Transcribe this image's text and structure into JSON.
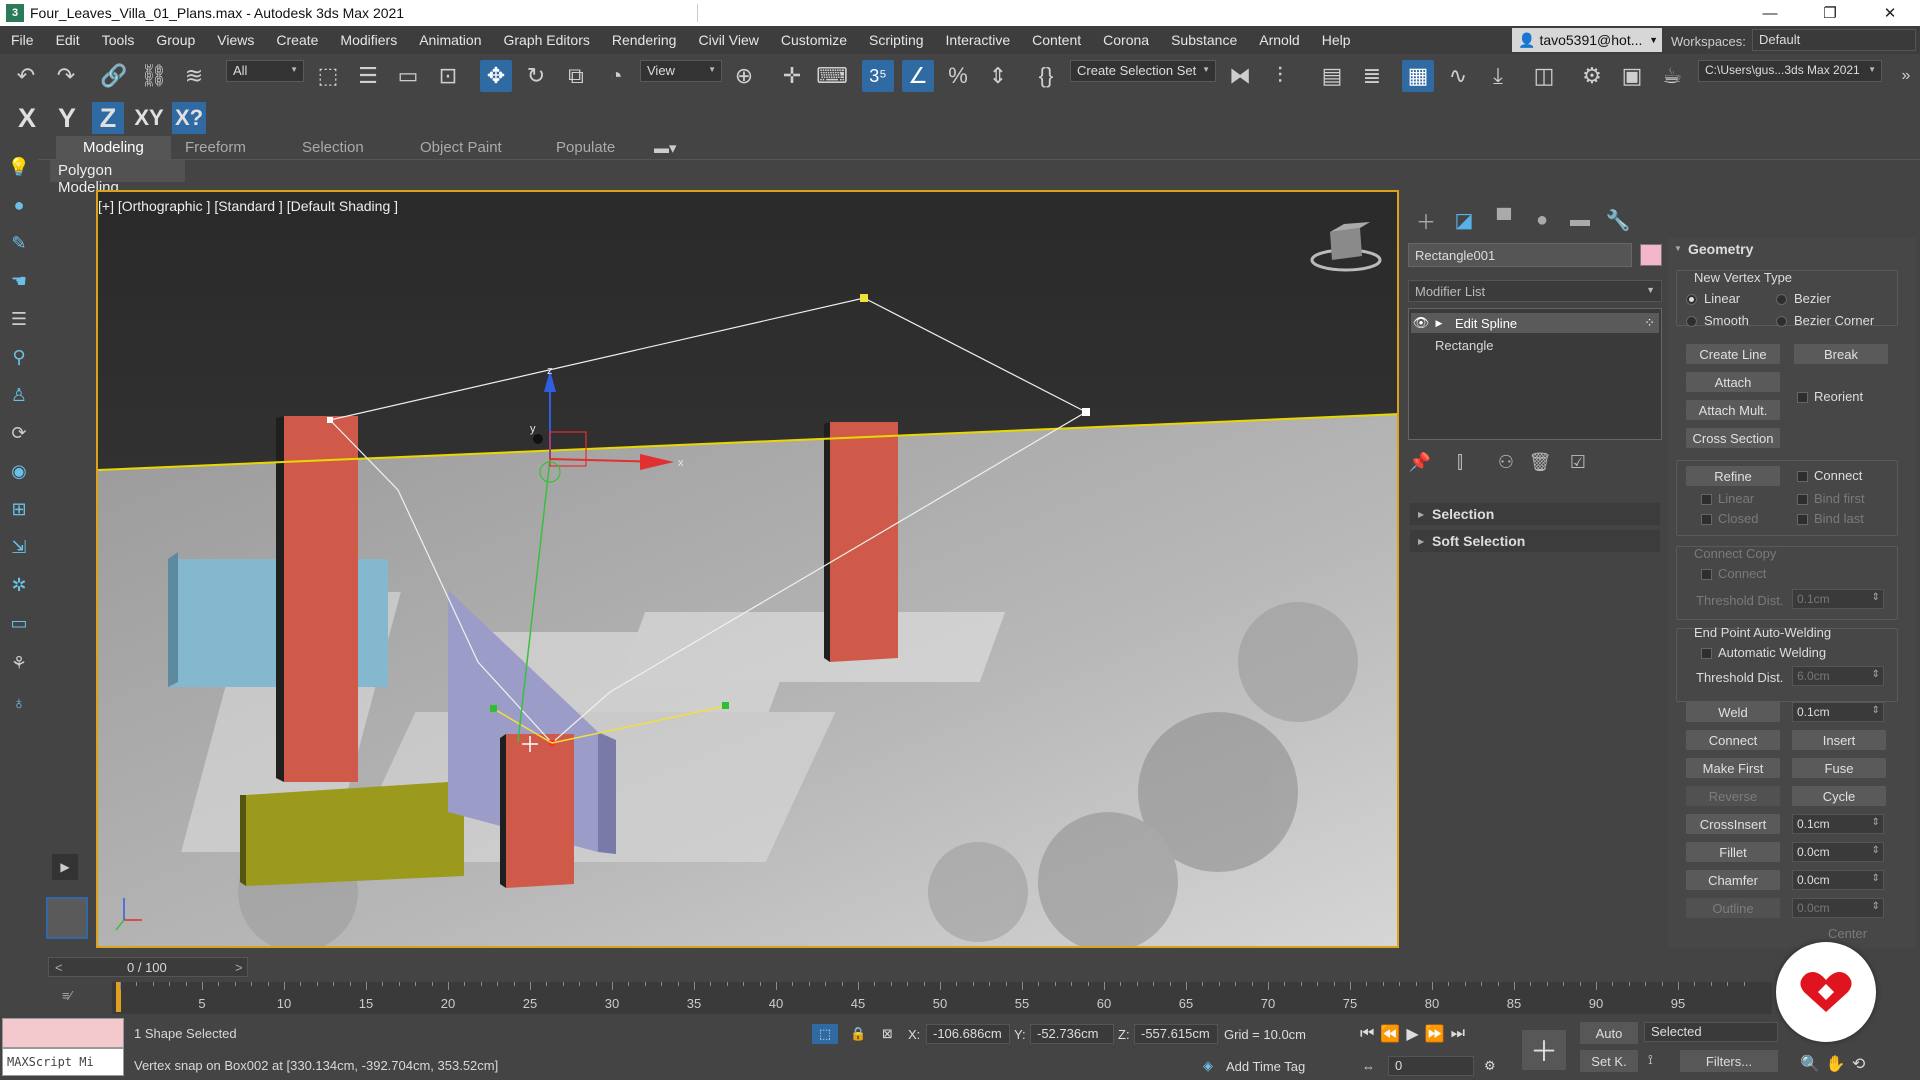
{
  "window": {
    "title": "Four_Leaves_Villa_01_Plans.max - Autodesk 3ds Max 2021",
    "app_icon": "3",
    "minimize": "—",
    "maximize": "❐",
    "close": "✕"
  },
  "menu": [
    "File",
    "Edit",
    "Tools",
    "Group",
    "Views",
    "Create",
    "Modifiers",
    "Animation",
    "Graph Editors",
    "Rendering",
    "Civil View",
    "Customize",
    "Scripting",
    "Interactive",
    "Content",
    "Corona",
    "Substance",
    "Arnold",
    "Help"
  ],
  "user": {
    "name": "tavo5391@hot...",
    "workspaces_label": "Workspaces:",
    "workspace": "Default"
  },
  "toolbar": {
    "filter": "All",
    "ref_coord": "View",
    "selection_set": "Create Selection Set",
    "project_path": "C:\\Users\\gus...3ds Max 2021"
  },
  "axis": {
    "x": "X",
    "y": "Y",
    "z": "Z",
    "xy": "XY",
    "xz": "X?"
  },
  "ribbon": {
    "tabs": [
      "Modeling",
      "Freeform",
      "Selection",
      "Object Paint",
      "Populate"
    ],
    "panel": "Polygon Modeling"
  },
  "viewport": {
    "label": "[+] [Orthographic ] [Standard ] [Default Shading ]",
    "axis_x": "x",
    "axis_y": "y",
    "axis_z": "z"
  },
  "command_panel": {
    "object_name": "Rectangle001",
    "object_color": "#f4b6cd",
    "modifier_list": "Modifier List",
    "stack": [
      "Edit Spline",
      "Rectangle"
    ],
    "rollouts": [
      "Selection",
      "Soft Selection"
    ]
  },
  "geometry": {
    "title": "Geometry",
    "new_vertex_type": "New Vertex Type",
    "linear": "Linear",
    "bezier": "Bezier",
    "smooth": "Smooth",
    "bezier_corner": "Bezier Corner",
    "create_line": "Create Line",
    "break": "Break",
    "attach": "Attach",
    "reorient": "Reorient",
    "attach_mult": "Attach Mult.",
    "cross_section": "Cross Section",
    "refine": "Refine",
    "connect": "Connect",
    "ref_linear": "Linear",
    "bind_first": "Bind first",
    "closed": "Closed",
    "bind_last": "Bind last",
    "connect_copy": "Connect Copy",
    "cc_connect": "Connect",
    "threshold_dist": "Threshold Dist.",
    "threshold_val1": "0.1cm",
    "end_point": "End Point Auto-Welding",
    "auto_weld": "Automatic Welding",
    "threshold_val2": "6.0cm",
    "weld": "Weld",
    "weld_val": "0.1cm",
    "connect_btn": "Connect",
    "insert": "Insert",
    "make_first": "Make First",
    "fuse": "Fuse",
    "reverse": "Reverse",
    "cycle": "Cycle",
    "crossinsert": "CrossInsert",
    "crossinsert_val": "0.1cm",
    "fillet": "Fillet",
    "fillet_val": "0.0cm",
    "chamfer": "Chamfer",
    "chamfer_val": "0.0cm",
    "outline": "Outline",
    "outline_val": "0.0cm",
    "center": "Center"
  },
  "timeline": {
    "frame": "0 / 100",
    "prev": "<",
    "next": ">",
    "ticks": [
      0,
      5,
      10,
      15,
      20,
      25,
      30,
      35,
      40,
      45,
      50,
      55,
      60,
      65,
      70,
      75,
      80,
      85,
      90,
      95
    ]
  },
  "status": {
    "maxscript": "MAXScript Mi",
    "selected": "1 Shape Selected",
    "prompt": "Vertex snap on Box002 at [330.134cm, -392.704cm, 353.52cm]",
    "x_label": "X:",
    "x": "-106.686cm",
    "y_label": "Y:",
    "y": "-52.736cm",
    "z_label": "Z:",
    "z": "-557.615cm",
    "grid": "Grid = 10.0cm",
    "add_time_tag": "Add Time Tag",
    "auto": "Auto",
    "set_key": "Set K.",
    "key_mode": "Selected",
    "filters": "Filters...",
    "frame_field": "0"
  }
}
